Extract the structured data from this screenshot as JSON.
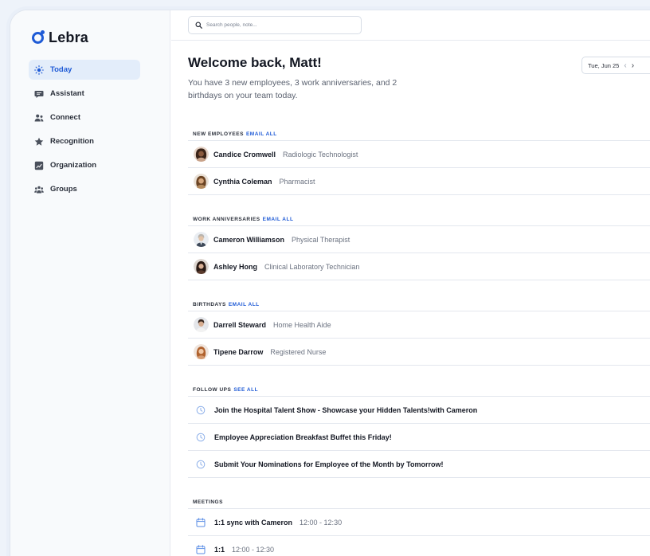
{
  "app": {
    "name": "Lebra",
    "accent": "#1f5bd6"
  },
  "sidebar": {
    "items": [
      {
        "label": "Today",
        "icon": "sun-icon",
        "active": true
      },
      {
        "label": "Assistant",
        "icon": "chat-icon"
      },
      {
        "label": "Connect",
        "icon": "people-icon"
      },
      {
        "label": "Recognition",
        "icon": "star-icon"
      },
      {
        "label": "Organization",
        "icon": "chart-icon"
      },
      {
        "label": "Groups",
        "icon": "group-icon"
      }
    ]
  },
  "search": {
    "placeholder": "Search people, note..."
  },
  "header": {
    "title": "Welcome back, Matt!",
    "subtitle": "You have 3 new employees, 3 work anniversaries, and 2 birthdays on your team today.",
    "date": "Tue, Jun 25",
    "prev": "‹",
    "next": "›"
  },
  "sections": {
    "new_employees": {
      "title": "NEW EMPLOYEES",
      "link": "EMAIL ALL",
      "people": [
        {
          "name": "Candice Cromwell",
          "role": "Radiologic Technologist"
        },
        {
          "name": "Cynthia Coleman",
          "role": "Pharmacist"
        }
      ]
    },
    "work_anniversaries": {
      "title": "WORK ANNIVERSARIES",
      "link": "EMAIL ALL",
      "people": [
        {
          "name": "Cameron Williamson",
          "role": "Physical Therapist"
        },
        {
          "name": "Ashley Hong",
          "role": "Clinical Laboratory Technician"
        }
      ]
    },
    "birthdays": {
      "title": "BIRTHDAYS",
      "link": "EMAIL ALL",
      "people": [
        {
          "name": "Darrell Steward",
          "role": "Home Health Aide"
        },
        {
          "name": "Tipene Darrow",
          "role": "Registered Nurse"
        }
      ]
    },
    "follow_ups": {
      "title": "FOLLOW UPS",
      "link": "SEE ALL",
      "items": [
        {
          "text": "Join the Hospital Talent Show - Showcase your Hidden Talents!with Cameron"
        },
        {
          "text": "Employee Appreciation Breakfast Buffet this Friday!"
        },
        {
          "text": "Submit Your Nominations for Employee of the Month by Tomorrow!"
        }
      ]
    },
    "meetings": {
      "title": "MEETINGS",
      "items": [
        {
          "title": "1:1 sync with Cameron",
          "time": "12:00 - 12:30"
        },
        {
          "title": "1:1",
          "time": "12:00 - 12:30"
        }
      ]
    }
  }
}
